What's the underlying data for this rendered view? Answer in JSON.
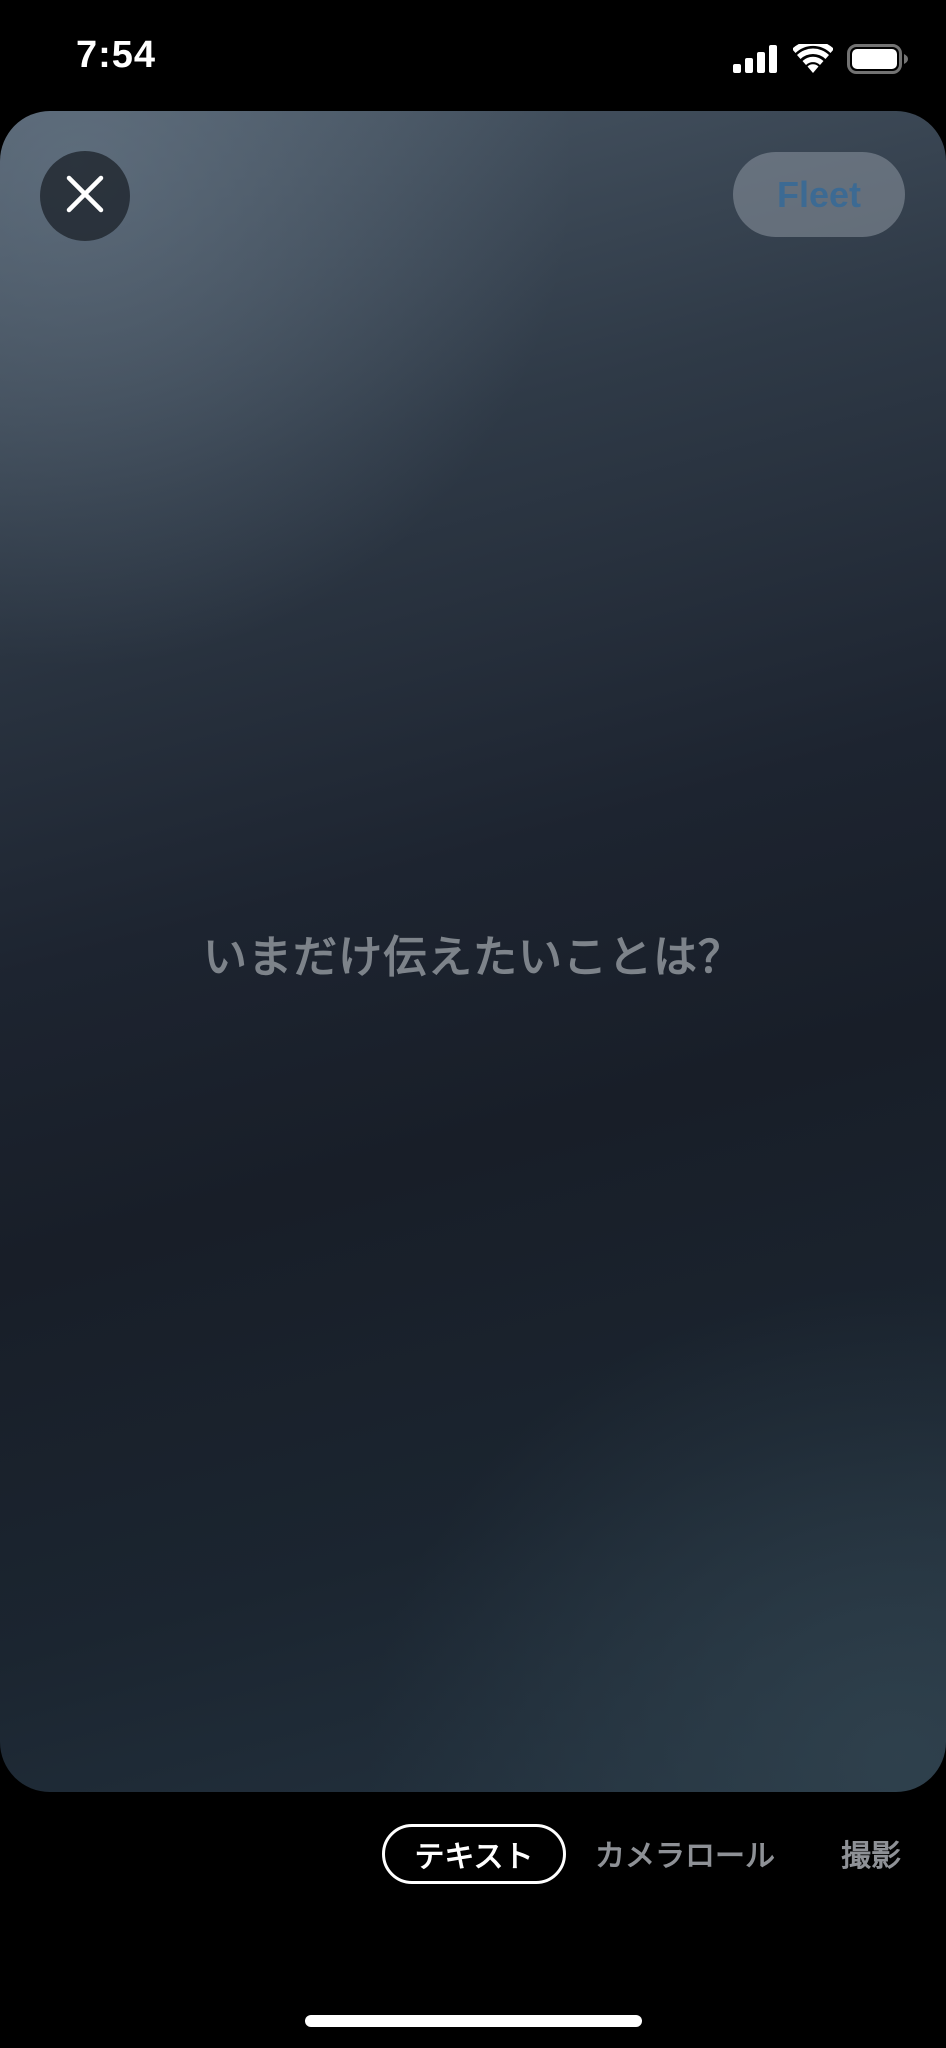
{
  "status_bar": {
    "time": "7:54",
    "icons": [
      "cellular-signal-icon",
      "wifi-icon",
      "battery-icon"
    ]
  },
  "compose": {
    "close_icon": "close-icon",
    "fleet_label": "Fleet",
    "prompt_placeholder": "いまだけ伝えたいことは？"
  },
  "mode_tabs": {
    "items": [
      {
        "label": "テキスト",
        "selected": true
      },
      {
        "label": "カメラロール",
        "selected": false
      },
      {
        "label": "撮影",
        "selected": false
      }
    ]
  },
  "colors": {
    "fleet_text": "#3c6a93",
    "prompt_text": "#7d838a",
    "selected_tab_border": "#ffffff",
    "unselected_tab_text": "#8e9196"
  }
}
